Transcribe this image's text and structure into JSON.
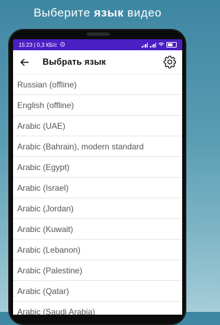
{
  "promo": {
    "title_part1": "Выберите ",
    "title_bold": "язык",
    "title_part2": " видео"
  },
  "status_bar": {
    "time_and_speed": "15:23 | 0,3 КБ/с",
    "color": "#4a1fc4"
  },
  "app_bar": {
    "back_icon": "arrow-back-icon",
    "title": "Выбрать язык",
    "settings_icon": "gear-icon"
  },
  "languages": [
    "Russian (offline)",
    "English (offline)",
    "Arabic (UAE)",
    "Arabic (Bahrain), modern standard",
    "Arabic (Egypt)",
    "Arabic (Israel)",
    "Arabic (Jordan)",
    "Arabic (Kuwait)",
    "Arabic (Lebanon)",
    "Arabic (Palestine)",
    "Arabic (Qatar)",
    "Arabic (Saudi Arabia)"
  ]
}
